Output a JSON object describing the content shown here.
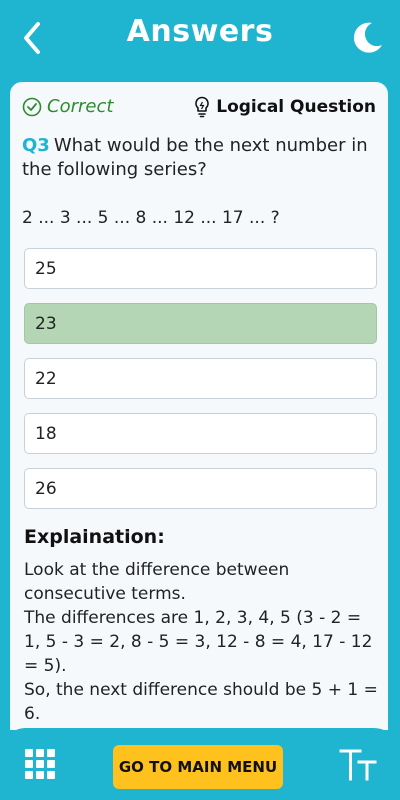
{
  "header": {
    "title": "Answers",
    "back_icon": "chevron-left-icon",
    "theme_icon": "moon-icon"
  },
  "status": {
    "result_label": "Correct",
    "result_icon": "check-circle-icon",
    "category_label": "Logical Question",
    "category_icon": "lightbulb-icon"
  },
  "question": {
    "number": "Q3",
    "text": "What would be the next number in the following series?",
    "series": "2 ... 3 ... 5 ... 8 ... 12 ... 17 ... ?"
  },
  "options": [
    {
      "label": "25",
      "selected": false
    },
    {
      "label": "23",
      "selected": true
    },
    {
      "label": "22",
      "selected": false
    },
    {
      "label": "18",
      "selected": false
    },
    {
      "label": "26",
      "selected": false
    }
  ],
  "explanation": {
    "title": "Explaination:",
    "line1": "Look at the difference between consecutive terms.",
    "line2": "The differences are 1, 2, 3, 4, 5 (3 - 2 = 1, 5 - 3 = 2, 8 - 5 = 3, 12 - 8 = 4, 17 - 12 = 5).",
    "line3": "So, the next difference should be 5 + 1 = 6."
  },
  "bottom_bar": {
    "main_menu_label": "GO TO MAIN MENU",
    "grid_icon": "grid-icon",
    "text_size_icon": "text-size-icon"
  },
  "colors": {
    "primary": "#1fb5d0",
    "correct": "#2e8b2e",
    "selected_option": "#b4d6b4",
    "button": "#ffc11e"
  }
}
